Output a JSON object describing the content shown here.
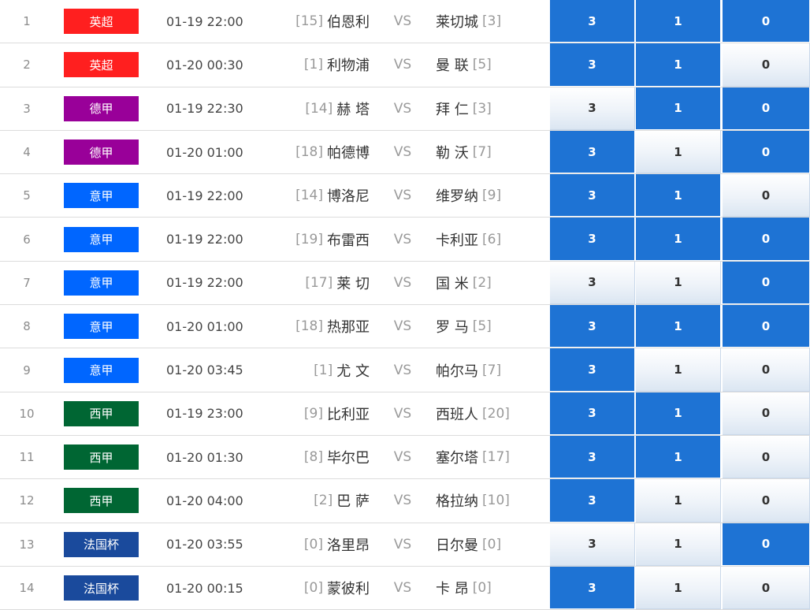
{
  "colors": {
    "selected": "#1e73d4",
    "premier_league": "#ff1f1f",
    "bundesliga": "#990099",
    "serie_a": "#0066ff",
    "la_liga": "#006633",
    "coupe_de_france": "#1a4a9c"
  },
  "vs_label": "VS",
  "rows": [
    {
      "no": "1",
      "league": "英超",
      "league_color": "#ff1f1f",
      "time": "01-19 22:00",
      "home_rank": "[15]",
      "home": "伯恩利",
      "away": "莱切城",
      "away_rank": "[3]",
      "options": [
        {
          "label": "3",
          "selected": true
        },
        {
          "label": "1",
          "selected": true
        },
        {
          "label": "0",
          "selected": true
        }
      ]
    },
    {
      "no": "2",
      "league": "英超",
      "league_color": "#ff1f1f",
      "time": "01-20 00:30",
      "home_rank": "[1]",
      "home": "利物浦",
      "away": "曼 联",
      "away_rank": "[5]",
      "options": [
        {
          "label": "3",
          "selected": true
        },
        {
          "label": "1",
          "selected": true
        },
        {
          "label": "0",
          "selected": false
        }
      ]
    },
    {
      "no": "3",
      "league": "德甲",
      "league_color": "#990099",
      "time": "01-19 22:30",
      "home_rank": "[14]",
      "home": "赫 塔",
      "away": "拜 仁",
      "away_rank": "[3]",
      "options": [
        {
          "label": "3",
          "selected": false
        },
        {
          "label": "1",
          "selected": true
        },
        {
          "label": "0",
          "selected": true
        }
      ]
    },
    {
      "no": "4",
      "league": "德甲",
      "league_color": "#990099",
      "time": "01-20 01:00",
      "home_rank": "[18]",
      "home": "帕德博",
      "away": "勒 沃",
      "away_rank": "[7]",
      "options": [
        {
          "label": "3",
          "selected": true
        },
        {
          "label": "1",
          "selected": false
        },
        {
          "label": "0",
          "selected": true
        }
      ]
    },
    {
      "no": "5",
      "league": "意甲",
      "league_color": "#0066ff",
      "time": "01-19 22:00",
      "home_rank": "[14]",
      "home": "博洛尼",
      "away": "维罗纳",
      "away_rank": "[9]",
      "options": [
        {
          "label": "3",
          "selected": true
        },
        {
          "label": "1",
          "selected": true
        },
        {
          "label": "0",
          "selected": false
        }
      ]
    },
    {
      "no": "6",
      "league": "意甲",
      "league_color": "#0066ff",
      "time": "01-19 22:00",
      "home_rank": "[19]",
      "home": "布雷西",
      "away": "卡利亚",
      "away_rank": "[6]",
      "options": [
        {
          "label": "3",
          "selected": true
        },
        {
          "label": "1",
          "selected": true
        },
        {
          "label": "0",
          "selected": true
        }
      ]
    },
    {
      "no": "7",
      "league": "意甲",
      "league_color": "#0066ff",
      "time": "01-19 22:00",
      "home_rank": "[17]",
      "home": "莱 切",
      "away": "国 米",
      "away_rank": "[2]",
      "options": [
        {
          "label": "3",
          "selected": false
        },
        {
          "label": "1",
          "selected": false
        },
        {
          "label": "0",
          "selected": true
        }
      ]
    },
    {
      "no": "8",
      "league": "意甲",
      "league_color": "#0066ff",
      "time": "01-20 01:00",
      "home_rank": "[18]",
      "home": "热那亚",
      "away": "罗 马",
      "away_rank": "[5]",
      "options": [
        {
          "label": "3",
          "selected": true
        },
        {
          "label": "1",
          "selected": true
        },
        {
          "label": "0",
          "selected": true
        }
      ]
    },
    {
      "no": "9",
      "league": "意甲",
      "league_color": "#0066ff",
      "time": "01-20 03:45",
      "home_rank": "[1]",
      "home": "尤 文",
      "away": "帕尔马",
      "away_rank": "[7]",
      "options": [
        {
          "label": "3",
          "selected": true
        },
        {
          "label": "1",
          "selected": false
        },
        {
          "label": "0",
          "selected": false
        }
      ]
    },
    {
      "no": "10",
      "league": "西甲",
      "league_color": "#006633",
      "time": "01-19 23:00",
      "home_rank": "[9]",
      "home": "比利亚",
      "away": "西班人",
      "away_rank": "[20]",
      "options": [
        {
          "label": "3",
          "selected": true
        },
        {
          "label": "1",
          "selected": true
        },
        {
          "label": "0",
          "selected": false
        }
      ]
    },
    {
      "no": "11",
      "league": "西甲",
      "league_color": "#006633",
      "time": "01-20 01:30",
      "home_rank": "[8]",
      "home": "毕尔巴",
      "away": "塞尔塔",
      "away_rank": "[17]",
      "options": [
        {
          "label": "3",
          "selected": true
        },
        {
          "label": "1",
          "selected": true
        },
        {
          "label": "0",
          "selected": false
        }
      ]
    },
    {
      "no": "12",
      "league": "西甲",
      "league_color": "#006633",
      "time": "01-20 04:00",
      "home_rank": "[2]",
      "home": "巴 萨",
      "away": "格拉纳",
      "away_rank": "[10]",
      "options": [
        {
          "label": "3",
          "selected": true
        },
        {
          "label": "1",
          "selected": false
        },
        {
          "label": "0",
          "selected": false
        }
      ]
    },
    {
      "no": "13",
      "league": "法国杯",
      "league_color": "#1a4a9c",
      "time": "01-20 03:55",
      "home_rank": "[0]",
      "home": "洛里昂",
      "away": "日尔曼",
      "away_rank": "[0]",
      "options": [
        {
          "label": "3",
          "selected": false
        },
        {
          "label": "1",
          "selected": false
        },
        {
          "label": "0",
          "selected": true
        }
      ]
    },
    {
      "no": "14",
      "league": "法国杯",
      "league_color": "#1a4a9c",
      "time": "01-20 00:15",
      "home_rank": "[0]",
      "home": "蒙彼利",
      "away": "卡 昂",
      "away_rank": "[0]",
      "options": [
        {
          "label": "3",
          "selected": true
        },
        {
          "label": "1",
          "selected": false
        },
        {
          "label": "0",
          "selected": false
        }
      ]
    }
  ]
}
